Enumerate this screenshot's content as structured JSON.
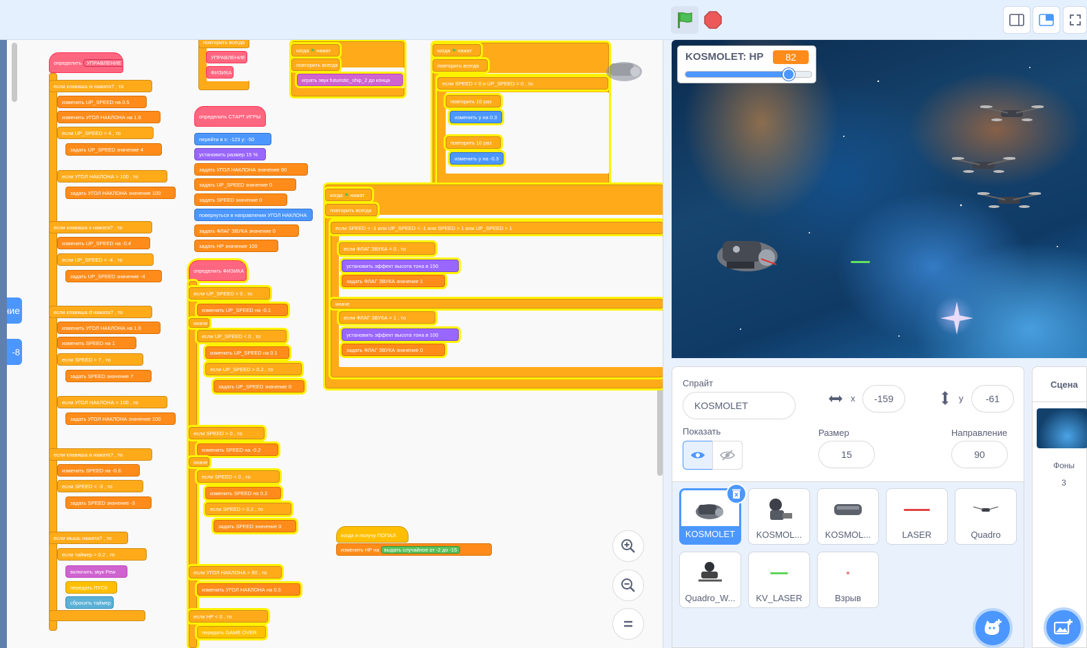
{
  "toolbar": {
    "green_flag": "green-flag-icon",
    "stop": "stop-icon"
  },
  "category_tabs": {
    "control_partial": "ние",
    "number_partial": "-8"
  },
  "scripts": {
    "b1": {
      "hat": "определить",
      "name": "УПРАВЛЕНИЕ",
      "if": "если",
      "key": "клавиша",
      "w": "w",
      "pressed": "нажата?",
      "then": ", то",
      "change": "изменить",
      "upspeed": "UP_SPEED",
      "by": "на",
      "v05": "0.5",
      "ugol": "УГОЛ НАКЛОНА",
      "v16": "1.6",
      "v4": "4",
      "set": "задать",
      "value": "значение",
      "v100": "100",
      "s": "s",
      "vm04": "-0.4",
      "vm4": "-4",
      "d": "d",
      "v1": "1",
      "speed": "SPEED",
      "v7": "7",
      "a": "a",
      "vm06": "-0.6",
      "vm3": "-3",
      "mouse": "мышь нажата?",
      "timer": "таймер",
      "v02": "0.2",
      "sound": "включить звук",
      "pew": "Pew",
      "broadcast": "передать",
      "pusk": "ПУСК",
      "reset": "сбросить таймер"
    },
    "b2": {
      "forever": "повторить всегда",
      "upr": "УПРАВЛЕНИЕ",
      "fiz": "ФИЗИКА"
    },
    "b3": {
      "hat": "определить",
      "name": "СТАРТ ИГРЫ",
      "goto": "перейти в x:",
      "x": "-123",
      "y_label": "y:",
      "y": "-50",
      "size": "установить размер",
      "size_v": "15",
      "pct": "%",
      "set": "задать",
      "ugol": "УГОЛ НАКЛОНА",
      "value": "значение",
      "v90": "90",
      "upspeed": "UP_SPEED",
      "v0": "0",
      "speed": "SPEED",
      "point": "повернуться в направлении",
      "flag": "ФЛАГ ЗВУКА",
      "hp": "HP",
      "v100": "100"
    },
    "b4": {
      "hat": "определить",
      "name": "ФИЗИКА",
      "if": "если",
      "upspeed": "UP_SPEED",
      "gt": ">",
      "lt": "<",
      "v0": "0",
      "then": ", то",
      "change": "изменить",
      "by": "на",
      "vm01": "-0.1",
      "else": "иначе",
      "v01": "0.1",
      "v02": "0.2",
      "set": "задать",
      "value": "значение",
      "speed": "SPEED",
      "vm02": "-0.2",
      "ugol": "УГОЛ НАКЛОНА",
      "v90": "90",
      "v05": "0.5",
      "hp": "HP",
      "broadcast": "передать",
      "gameover": "GAME OVER"
    },
    "b5": {
      "hat": "когда",
      "clicked": "нажат",
      "forever": "повторить всегда",
      "play": "играть звук",
      "sound": "futuristic_ship_2",
      "until": "до конца"
    },
    "b6": {
      "hat": "когда",
      "clicked": "нажат",
      "forever": "повторить всегда",
      "if": "если",
      "speed": "SPEED",
      "eq": "=",
      "v0": "0",
      "and": "и",
      "upspeed": "UP_SPEED",
      "then": ", то",
      "repeat": "повторить",
      "v10": "10",
      "times": "раз",
      "changey": "изменить y на",
      "v03": "0.3",
      "vm03": "-0.3"
    },
    "b7": {
      "hat": "когда",
      "clicked": "нажат",
      "forever": "повторить всегда",
      "if": "если",
      "speed": "SPEED",
      "lt": "<",
      "gt": ">",
      "vm1": "-1",
      "or": "или",
      "upspeed": "UP_SPEED",
      "v1": "1",
      "flag": "ФЛАГ ЗВУКА",
      "eq": "=",
      "v0": "0",
      "then": ", то",
      "effect": "установить эффект",
      "pitch": "высота тона",
      "to": "в",
      "v150": "150",
      "set": "задать",
      "value": "значение",
      "else": "иначе",
      "v100": "100"
    },
    "b8": {
      "hat": "когда я получу",
      "msg": "ПОПАЛ",
      "change": "изменить",
      "hp": "HP",
      "by": "на",
      "random": "выдать случайное от",
      "from": "-2",
      "to_label": "до",
      "to": "-15"
    }
  },
  "stage": {
    "hp_label": "KOSMOLET: HP",
    "hp_value": "82",
    "hp_fraction": 0.82
  },
  "sprite_info": {
    "sprite_label": "Спрайт",
    "sprite_name": "KOSMOLET",
    "x_label": "x",
    "x_value": "-159",
    "y_label": "y",
    "y_value": "-61",
    "show_label": "Показать",
    "size_label": "Размер",
    "size_value": "15",
    "direction_label": "Направление",
    "direction_value": "90"
  },
  "sprites": [
    {
      "name": "KOSMOLET",
      "selected": true
    },
    {
      "name": "KOSMOL..."
    },
    {
      "name": "KOSMOL..."
    },
    {
      "name": "LASER"
    },
    {
      "name": "Quadro"
    },
    {
      "name": "Quadro_W..."
    },
    {
      "name": "KV_LASER"
    },
    {
      "name": "Взрыв"
    }
  ],
  "stage_panel": {
    "title": "Сцена",
    "backdrops_label": "Фоны",
    "backdrops_count": "3"
  },
  "colors": {
    "accent": "#4c97ff",
    "control": "#ffab19",
    "variables": "#ff8c1a",
    "operators": "#59c059",
    "motion": "#4c97ff",
    "myblocks": "#ff6680",
    "looks": "#9966ff",
    "sound": "#cf63cf",
    "glow": "#fff200"
  }
}
